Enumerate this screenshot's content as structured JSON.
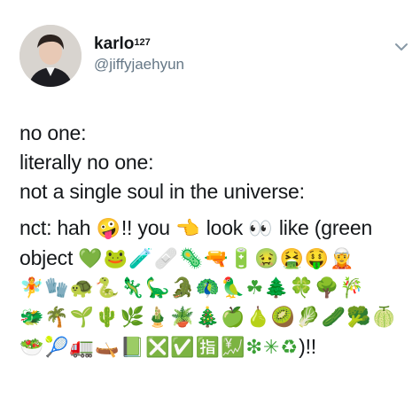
{
  "author": {
    "display_name": "karlo",
    "badge": "127",
    "handle": "@jiffyjaehyun",
    "colors": {
      "name": "#14171a",
      "handle": "#657786"
    }
  },
  "tweet": {
    "line1": "no one:",
    "line2": "literally no one:",
    "line3": "not a single soul in the universe:",
    "line4_a": "nct: hah ",
    "line4_e1": "🤪",
    "line4_b": "!! you ",
    "line4_e2": "👈",
    "line4_c": " look ",
    "line4_e3": "👀",
    "line4_d": " like (green",
    "line5_a": "object ",
    "line5_emojis": "💚🐸🧪🩹🦠🔫🔋🤢🤮🤑🧝",
    "line6_emojis": "🧚🧤🐢🐍🦎🦕🐊🦚🦜☘🌲🍀🌳🎋",
    "line7_emojis": "🐲🌴🌱🌵🌿🎍🪴🎄🍏🍐🥝🥬🥒🥦🍈",
    "line8_emojis": "🥗🎾🚛🛶📗❎✅🈯💹❇✳♻",
    "line8_end": ")!!"
  },
  "icons": {
    "chevron": "chevron-down-icon",
    "avatar": "avatar"
  }
}
